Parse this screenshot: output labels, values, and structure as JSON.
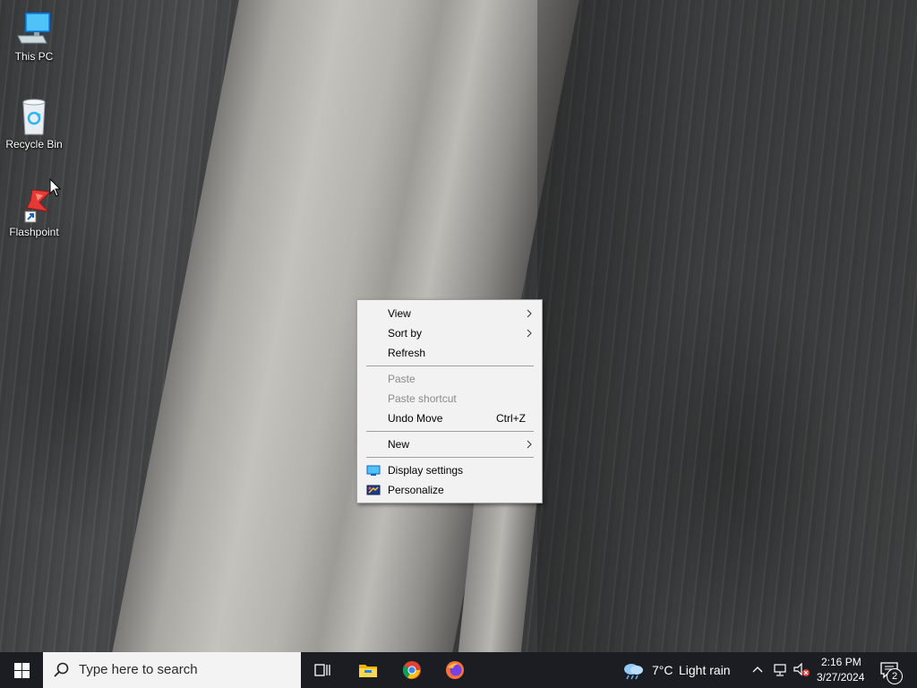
{
  "desktop": {
    "icons": [
      {
        "label": "This PC",
        "icon": "computer-icon"
      },
      {
        "label": "Recycle Bin",
        "icon": "recycle-bin-icon"
      },
      {
        "label": "Flashpoint",
        "icon": "flashpoint-icon"
      }
    ]
  },
  "context_menu": {
    "items": {
      "view": "View",
      "sort_by": "Sort by",
      "refresh": "Refresh",
      "paste": "Paste",
      "paste_shortcut": "Paste shortcut",
      "undo_move": "Undo Move",
      "undo_move_shortcut": "Ctrl+Z",
      "new": "New",
      "display_settings": "Display settings",
      "personalize": "Personalize"
    }
  },
  "taskbar": {
    "search_placeholder": "Type here to search",
    "weather": {
      "temp": "7°C",
      "condition": "Light rain"
    },
    "clock": {
      "time": "2:16 PM",
      "date": "3/27/2024"
    },
    "notification_count": "2",
    "pinned": [
      "task-view-icon",
      "file-explorer-icon",
      "chrome-icon",
      "firefox-icon"
    ]
  },
  "colors": {
    "taskbar_bg": "#1b1d22",
    "menu_bg": "#f2f2f2",
    "disabled_text": "#8a8a8a"
  }
}
